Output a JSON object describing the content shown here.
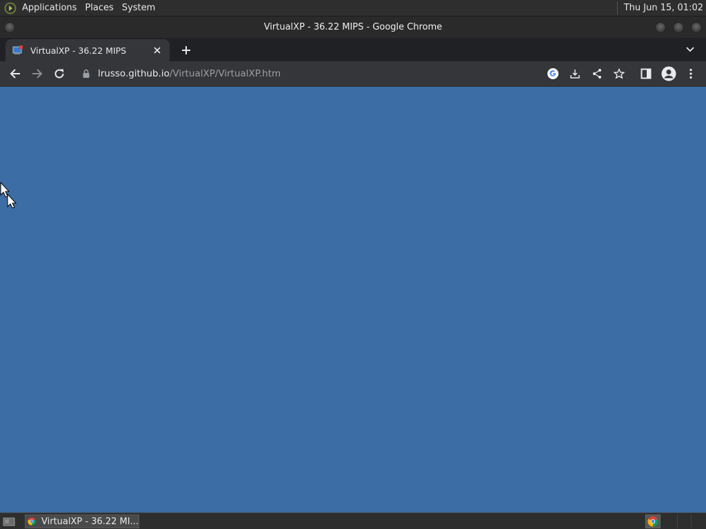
{
  "top_panel": {
    "menus": [
      "Applications",
      "Places",
      "System"
    ],
    "clock": "Thu Jun 15, 01:02"
  },
  "window": {
    "title": "VirtualXP - 36.22 MIPS - Google Chrome"
  },
  "browser": {
    "tab": {
      "title": "VirtualXP - 36.22 MIPS"
    },
    "omnibox": {
      "host": "lrusso.github.io",
      "path": "/VirtualXP/VirtualXP.htm"
    }
  },
  "page": {
    "background_color": "#3c6ea5"
  },
  "taskbar": {
    "window_button_label": "VirtualXP - 36.22 MI..."
  }
}
